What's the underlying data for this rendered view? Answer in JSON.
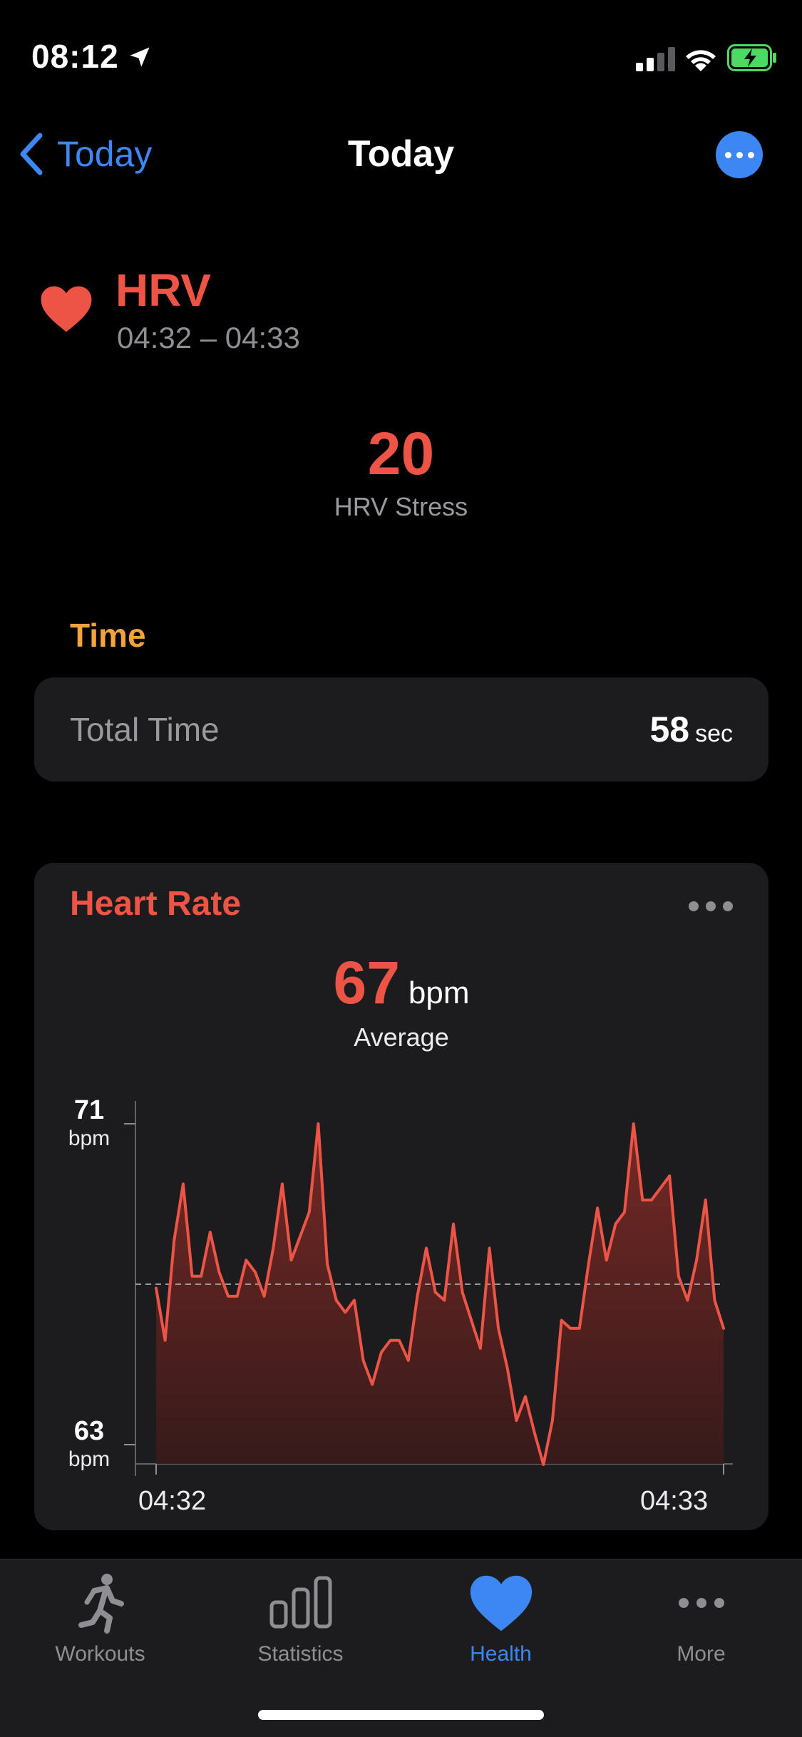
{
  "status": {
    "time": "08:12"
  },
  "nav": {
    "back_label": "Today",
    "title": "Today"
  },
  "header": {
    "title": "HRV",
    "time_range": "04:32 – 04:33"
  },
  "stress": {
    "value": "20",
    "label": "HRV Stress"
  },
  "time_section": {
    "title": "Time",
    "row_label": "Total Time",
    "value": "58",
    "unit": "sec"
  },
  "heart_rate": {
    "title": "Heart Rate",
    "average_value": "67",
    "average_unit": "bpm",
    "average_label": "Average"
  },
  "chart_data": {
    "type": "area",
    "title": "Heart Rate",
    "ylim": [
      63,
      71
    ],
    "y_ticks": [
      {
        "value": "71",
        "unit": "bpm"
      },
      {
        "value": "63",
        "unit": "bpm"
      }
    ],
    "x_tick_labels": [
      "04:32",
      "04:33"
    ],
    "average": 67,
    "series": [
      {
        "values": [
          66.9,
          65.6,
          68.1,
          69.5,
          67.2,
          67.2,
          68.3,
          67.3,
          66.7,
          66.7,
          67.6,
          67.3,
          66.7,
          67.9,
          69.5,
          67.6,
          68.2,
          68.8,
          71,
          67.5,
          66.6,
          66.3,
          66.6,
          65.1,
          64.5,
          65.3,
          65.6,
          65.6,
          65.1,
          66.7,
          67.9,
          66.8,
          66.6,
          68.5,
          66.8,
          66.1,
          65.4,
          67.9,
          65.9,
          64.9,
          63.6,
          64.2,
          63.3,
          62.5,
          63.6,
          66.1,
          65.9,
          65.9,
          67.5,
          68.9,
          67.6,
          68.5,
          68.8,
          71,
          69.1,
          69.1,
          69.4,
          69.7,
          67.2,
          66.6,
          67.6,
          69.1,
          66.6,
          65.9
        ]
      }
    ],
    "line_color": "#ee5446",
    "grid": false
  },
  "tabs": [
    {
      "label": "Workouts",
      "icon": "runner-icon",
      "active": false
    },
    {
      "label": "Statistics",
      "icon": "bar-chart-icon",
      "active": false
    },
    {
      "label": "Health",
      "icon": "heart-icon",
      "active": true
    },
    {
      "label": "More",
      "icon": "more-dots-icon",
      "active": false
    }
  ],
  "colors": {
    "accent": "#3d87f5",
    "health_red": "#ee5446",
    "time_orange": "#f4a23a",
    "battery_green": "#4cd964"
  }
}
